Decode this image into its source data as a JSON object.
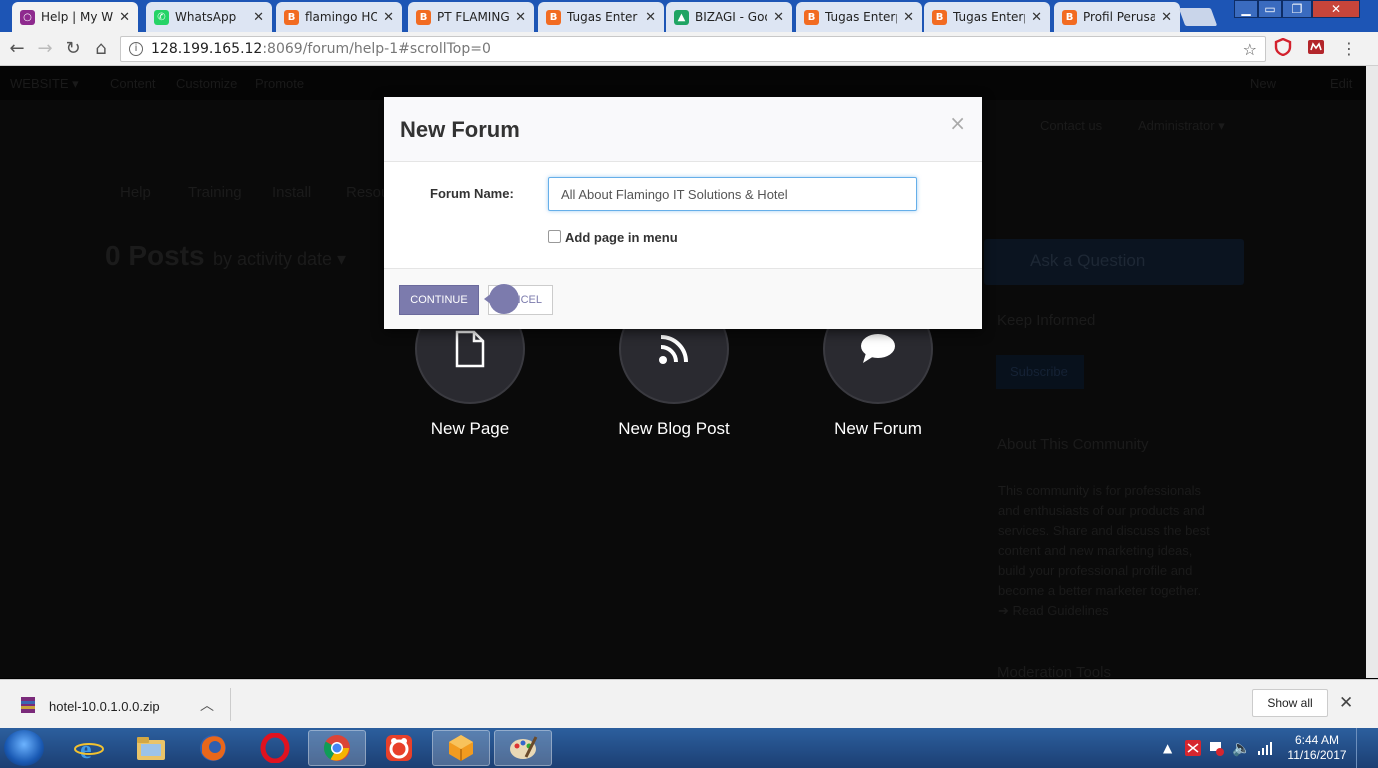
{
  "browser": {
    "tabs": [
      {
        "title": "Help | My We",
        "color": "#8e2a8e",
        "glyph": "○"
      },
      {
        "title": "WhatsApp",
        "color": "#25d366",
        "glyph": "✆"
      },
      {
        "title": "flamingo HO",
        "color": "#f26b21",
        "glyph": "B"
      },
      {
        "title": "PT FLAMING",
        "color": "#f26b21",
        "glyph": "B"
      },
      {
        "title": "Tugas Enter",
        "color": "#f26b21",
        "glyph": "B"
      },
      {
        "title": "BIZAGI - Goo",
        "color": "#1fa463",
        "glyph": "▲"
      },
      {
        "title": "Tugas Enterp",
        "color": "#f26b21",
        "glyph": "B"
      },
      {
        "title": "Tugas Enterp",
        "color": "#f26b21",
        "glyph": "B"
      },
      {
        "title": "Profil Perusa",
        "color": "#f26b21",
        "glyph": "B"
      }
    ],
    "tab_close": "✕",
    "url_host": "128.199.165.12",
    "url_path": ":8069/forum/help-1#scrollTop=0"
  },
  "background": {
    "top_menu": [
      "WEBSITE ▾",
      "Content",
      "Customize",
      "Promote"
    ],
    "top_right": [
      "New",
      "Edit"
    ],
    "header_links": [
      "Contact us",
      "Administrator ▾"
    ],
    "nav_items": [
      "Help",
      "Training",
      "Install",
      "Resou"
    ],
    "posts_title": "0 Posts",
    "posts_sub": "by activity date ▾",
    "ask_question": "Ask a Question",
    "keep_informed": "Keep Informed",
    "subscribe": "Subscribe",
    "about_title": "About This Community",
    "about_text": [
      "This community is for professionals",
      "and enthusiasts of our products and",
      "services. Share and discuss the best",
      "content and new marketing ideas,",
      "build your professional profile and",
      "become a better marketer together."
    ],
    "read_guidelines": "➔ Read Guidelines",
    "moderation": "Moderation Tools",
    "circles": [
      {
        "label": "New Page",
        "icon": "file-icon"
      },
      {
        "label": "New Blog Post",
        "icon": "rss-icon"
      },
      {
        "label": "New Forum",
        "icon": "comment-icon"
      }
    ]
  },
  "modal": {
    "title": "New Forum",
    "close": "×",
    "forum_name_label": "Forum Name:",
    "forum_name_value": "All About Flamingo IT Solutions & Hotel",
    "add_menu_label": "Add page in menu",
    "continue_label": "CONTINUE",
    "cancel_label": "NCEL"
  },
  "downloads": {
    "file": "hotel-10.0.1.0.0.zip",
    "show_all": "Show all"
  },
  "taskbar": {
    "time": "6:44 AM",
    "date": "11/16/2017"
  }
}
